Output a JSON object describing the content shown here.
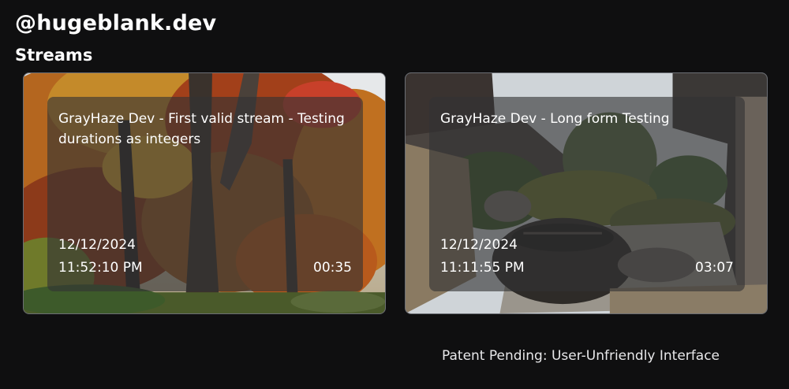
{
  "header": {
    "handle": "@hugeblank.dev",
    "section_title": "Streams"
  },
  "streams": [
    {
      "title": "GrayHaze Dev - First valid stream - Testing durations as integers",
      "date": "12/12/2024",
      "time": "11:52:10 PM",
      "duration": "00:35"
    },
    {
      "title": "GrayHaze Dev - Long form Testing",
      "date": "12/12/2024",
      "time": "11:11:55 PM",
      "duration": "03:07"
    }
  ],
  "footer": {
    "text": "Patent Pending: User-Unfriendly Interface"
  },
  "colors": {
    "background": "#0f0f10",
    "text": "#ffffff",
    "card_border": "#6c6f75",
    "overlay": "rgba(50,50,52,0.62)"
  }
}
